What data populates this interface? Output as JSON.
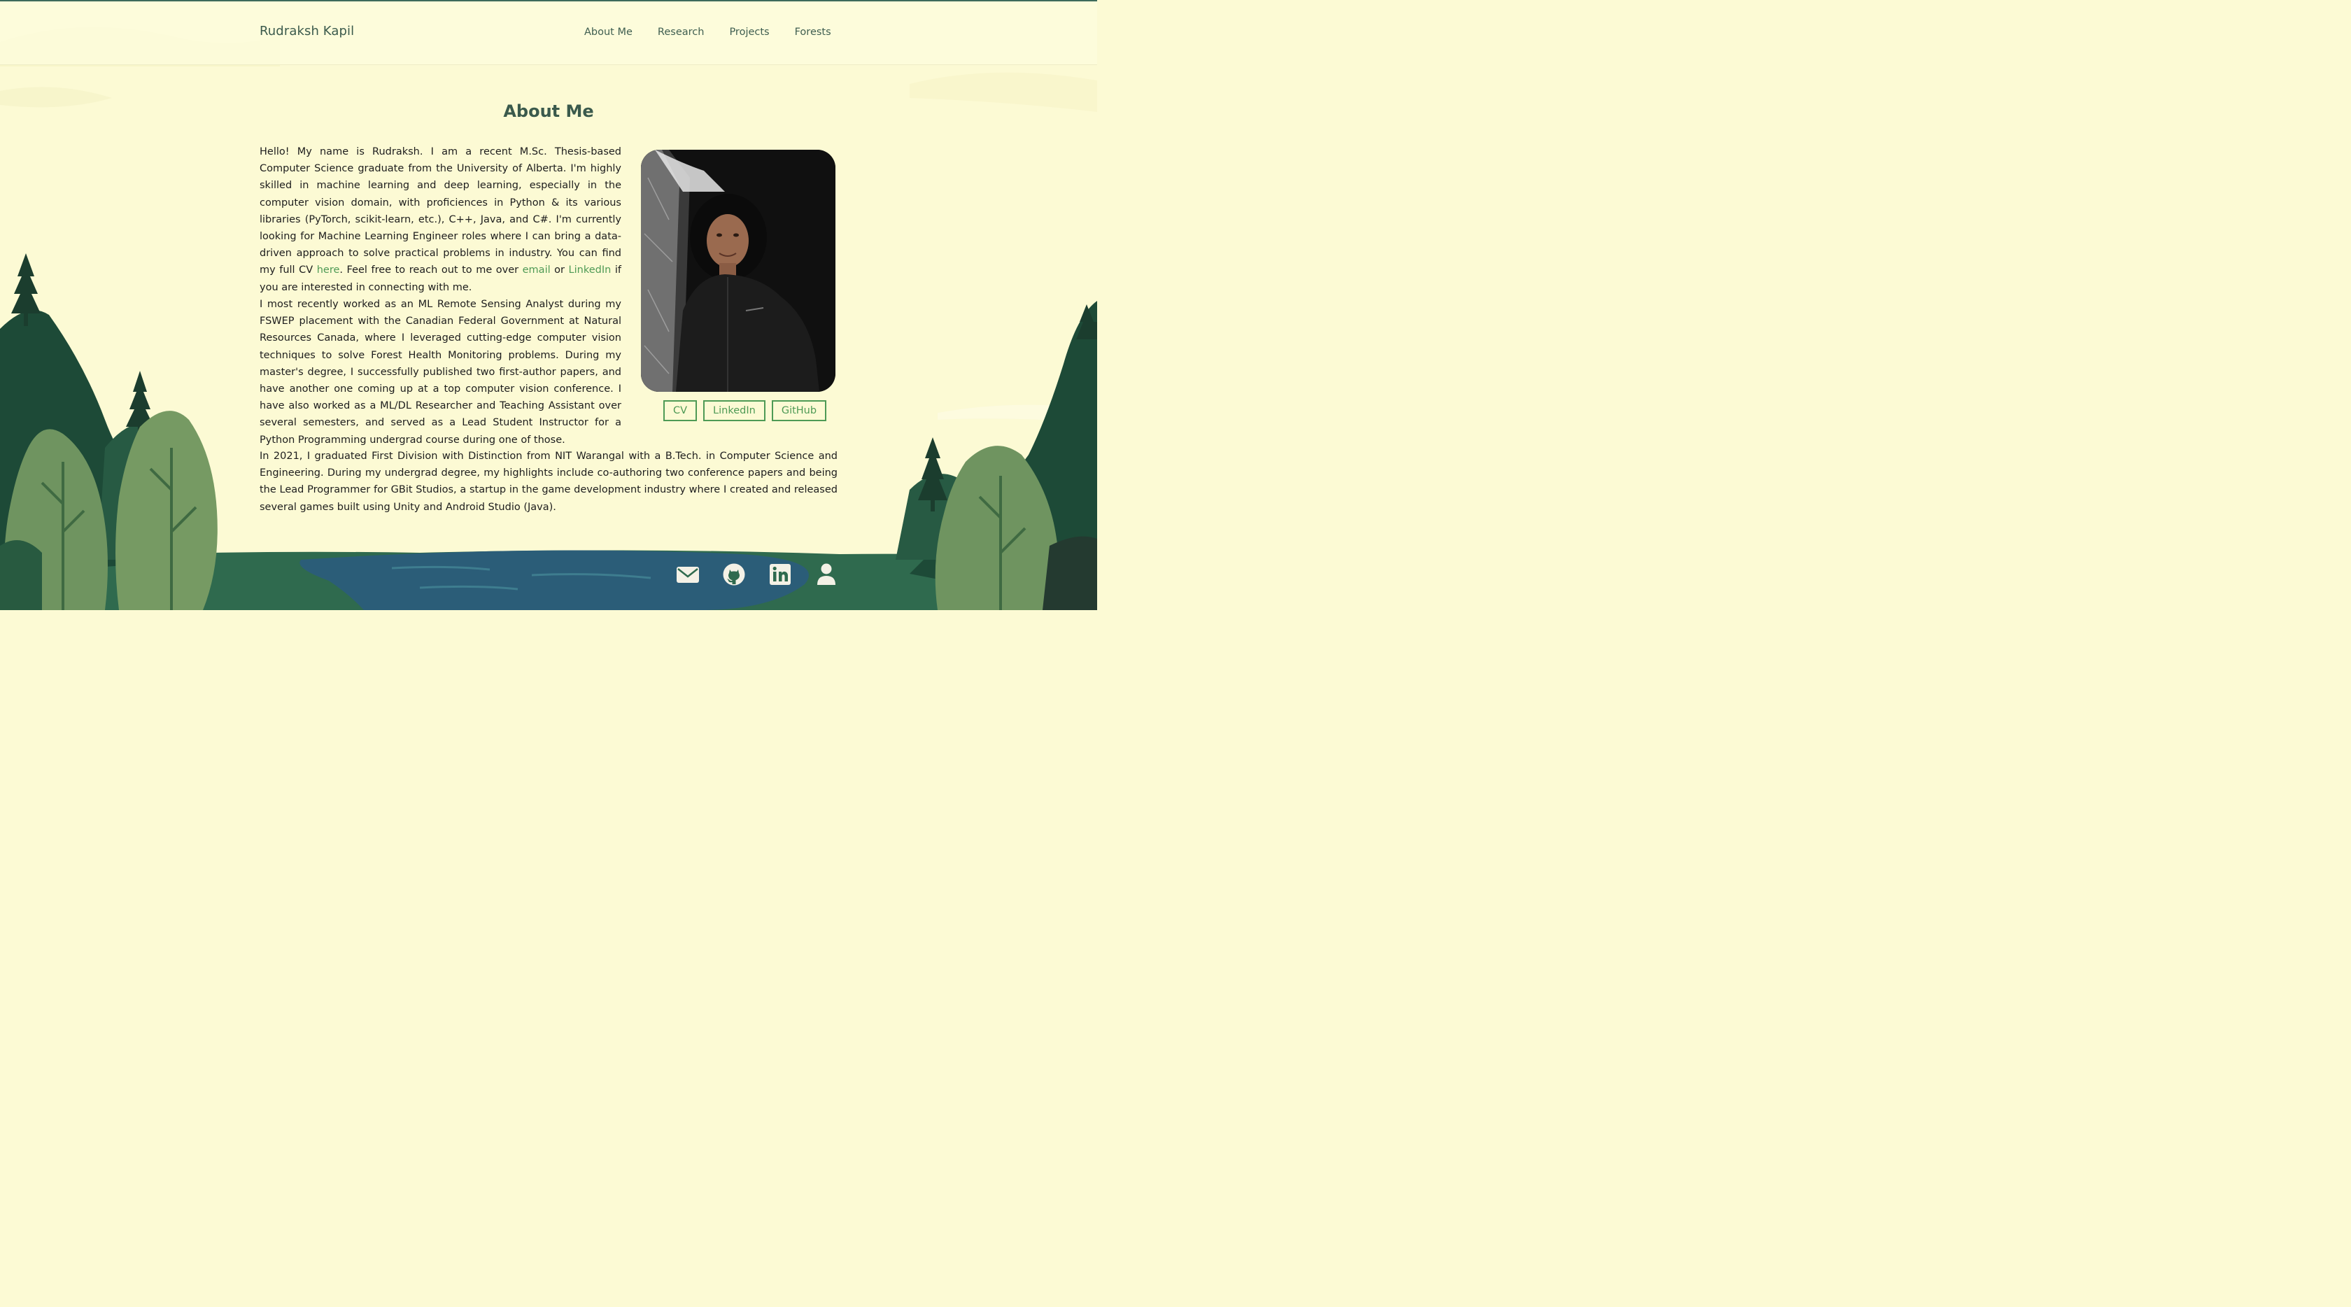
{
  "site": {
    "brand": "Rudraksh Kapil",
    "nav": [
      "About Me",
      "Research",
      "Projects",
      "Forests"
    ]
  },
  "about": {
    "title": "About Me",
    "p1": {
      "before_cv": "Hello! My name is Rudraksh. I am a recent M.Sc. Thesis-based Computer Science graduate from the University of Alberta. I'm highly skilled in machine learning and deep learning, especially in the computer vision domain, with proficiences in Python & its various libraries (PyTorch, scikit-learn, etc.), C++, Java, and C#. I'm currently looking for Machine Learning Engineer roles where I can bring a data-driven approach to solve practical problems in industry. You can find my full CV ",
      "cv_link": "here",
      "mid1": ". Feel free to reach out to me over ",
      "email_link": "email",
      "mid2": " or ",
      "linkedin_link": "LinkedIn",
      "after": " if you are interested in connecting with me."
    },
    "p2": "I most recently worked as an ML Remote Sensing Analyst during my FSWEP placement with the Canadian Federal Government at Natural Resources Canada, where I leveraged cutting-edge computer vision techniques to solve Forest Health Monitoring problems. During my master's degree, I successfully published two first-author papers, and have another one coming up at a top computer vision conference. I have also worked as a ML/DL Researcher and Teaching Assistant over several semesters, and served as a Lead Student Instructor for a Python Programming undergrad course during one of those.",
    "p3": "In 2021, I graduated First Division with Distinction from NIT Warangal with a B.Tech. in Computer Science and Engineering. During my undergrad degree, my highlights include co-authoring two conference papers and being the Lead Programmer for GBit Studios, a startup in the game development industry where I created and released several games built using Unity and Android Studio (Java).",
    "buttons": [
      "CV",
      "LinkedIn",
      "GitHub"
    ]
  },
  "footer": {
    "icons": [
      "envelope-icon",
      "github-icon",
      "linkedin-icon",
      "person-icon"
    ]
  },
  "colors": {
    "background": "#fcfad4",
    "heading": "#3b5a4c",
    "link": "#4e9a55",
    "forest_dark": "#1d4a37",
    "forest_light": "#6f9460",
    "lake": "#2b5d78"
  }
}
